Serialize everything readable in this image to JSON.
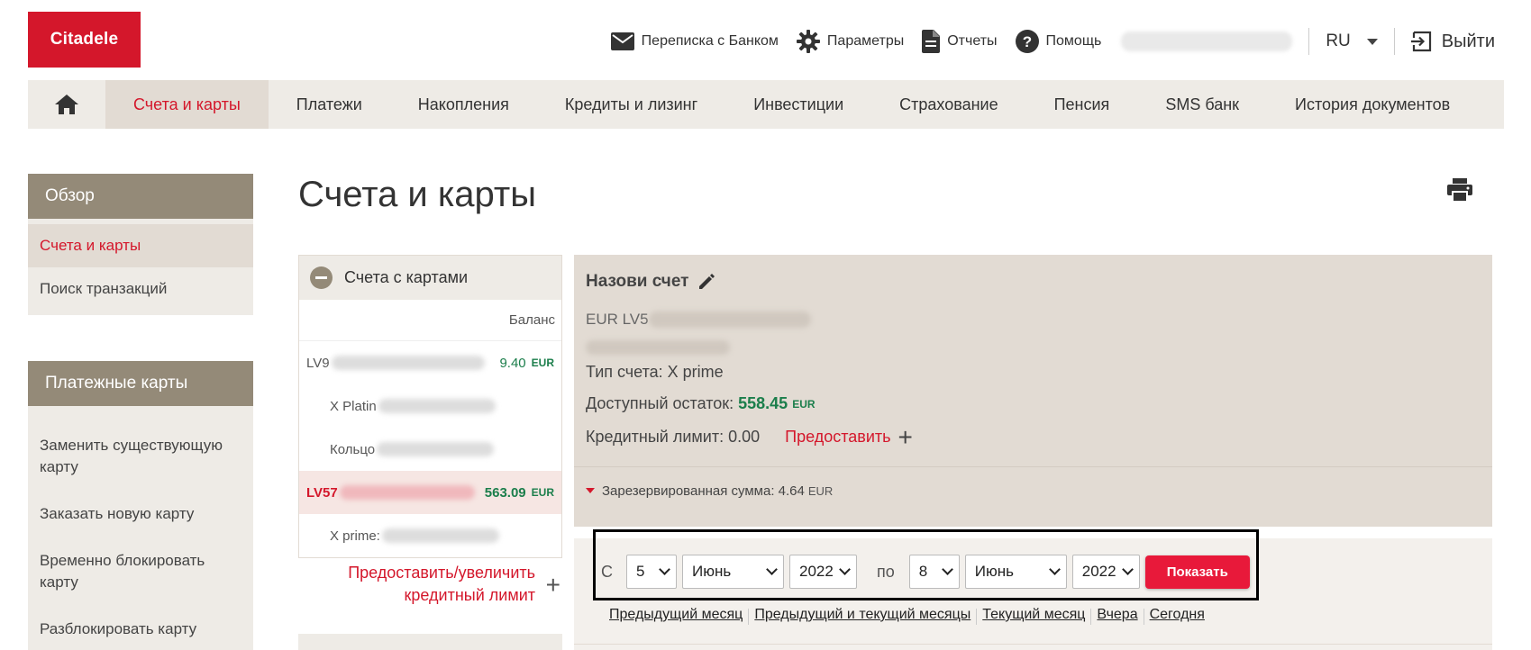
{
  "brand": {
    "logo_text": "Citadele",
    "color": "#d4172b"
  },
  "header": {
    "links": [
      {
        "label": "Переписка с Банком",
        "icon": "envelope-icon"
      },
      {
        "label": "Параметры",
        "icon": "gear-icon"
      },
      {
        "label": "Отчеты",
        "icon": "document-icon"
      },
      {
        "label": "Помощь",
        "icon": "help-icon"
      }
    ],
    "language": "RU",
    "logout_label": "Выйти"
  },
  "mainnav": {
    "home_icon": "home-icon",
    "tabs": [
      {
        "label": "Счета и карты",
        "active": true
      },
      {
        "label": "Платежи"
      },
      {
        "label": "Накопления"
      },
      {
        "label": "Кредиты и лизинг"
      },
      {
        "label": "Инвестиции"
      },
      {
        "label": "Страхование"
      },
      {
        "label": "Пенсия"
      },
      {
        "label": "SMS банк"
      },
      {
        "label": "История документов"
      }
    ]
  },
  "sidebar": {
    "overview": {
      "title": "Обзор",
      "items": [
        {
          "label": "Счета и карты",
          "active": true
        },
        {
          "label": "Поиск транзакций"
        }
      ]
    },
    "cards": {
      "title": "Платежные карты",
      "items": [
        {
          "label": "Заменить существующую карту"
        },
        {
          "label": "Заказать новую карту"
        },
        {
          "label": "Временно блокировать карту"
        },
        {
          "label": "Разблокировать карту"
        }
      ]
    }
  },
  "page": {
    "title": "Счета и карты",
    "print_icon": "print-icon"
  },
  "accounts": {
    "group_title": "Счета с картами",
    "balance_header": "Баланс",
    "rows": [
      {
        "iban": "LV9",
        "amount": "9.40",
        "currency": "EUR"
      },
      {
        "iban": "X Platin",
        "sub": true
      },
      {
        "iban": "Кольцо",
        "sub": true
      },
      {
        "iban": "LV57",
        "amount": "563.09",
        "currency": "EUR",
        "selected": true
      },
      {
        "iban": "X prime:",
        "sub": true
      }
    ],
    "credit_link": "Предоставить/увеличить кредитный лимит"
  },
  "details": {
    "name_label": "Назови счет",
    "iban": "EUR LV5",
    "account_type": "Тип счета: X prime",
    "available_label": "Доступный остаток:",
    "available_amount": "558.45",
    "available_currency": "EUR",
    "credit_limit": "Кредитный лимит: 0.00",
    "provide_label": "Предоставить",
    "reserved_label": "Зарезервированная сумма: 4.64",
    "reserved_currency": "EUR"
  },
  "filter": {
    "from_label": "С",
    "from_day": "5",
    "from_month": "Июнь",
    "from_year": "2022",
    "to_label": "по",
    "to_day": "8",
    "to_month": "Июнь",
    "to_year": "2022",
    "show_label": "Показать",
    "quick_links": [
      "Предыдущий месяц",
      "Предыдущий и текущий месяцы",
      "Текущий месяц",
      "Вчера",
      "Сегодня"
    ]
  }
}
